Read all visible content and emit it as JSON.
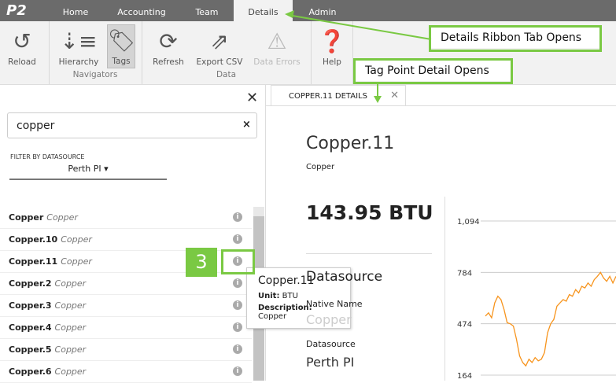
{
  "app": {
    "logo": "P2"
  },
  "tabs": [
    "Home",
    "Accounting",
    "Team",
    "Details",
    "Admin"
  ],
  "active_tab": "Details",
  "ribbon": {
    "buttons": [
      {
        "label": "Reload",
        "icon": "reload-icon"
      },
      {
        "label": "Hierarchy",
        "icon": "hierarchy-icon"
      },
      {
        "label": "Tags",
        "icon": "tag-icon",
        "selected": true
      },
      {
        "label": "Refresh",
        "icon": "refresh-icon"
      },
      {
        "label": "Export CSV",
        "icon": "export-icon"
      },
      {
        "label": "Data Errors",
        "icon": "warning-icon",
        "disabled": true
      },
      {
        "label": "Help",
        "icon": "help-icon"
      }
    ],
    "groups": [
      "Navigators",
      "Data"
    ]
  },
  "left": {
    "search_value": "copper",
    "filter_label": "FILTER BY DATASOURCE",
    "filter_value": "Perth PI",
    "items": [
      {
        "name": "Copper",
        "desc": "Copper"
      },
      {
        "name": "Copper.10",
        "desc": "Copper"
      },
      {
        "name": "Copper.11",
        "desc": "Copper"
      },
      {
        "name": "Copper.2",
        "desc": "Copper"
      },
      {
        "name": "Copper.3",
        "desc": "Copper"
      },
      {
        "name": "Copper.4",
        "desc": "Copper"
      },
      {
        "name": "Copper.5",
        "desc": "Copper"
      },
      {
        "name": "Copper.6",
        "desc": "Copper"
      }
    ]
  },
  "tooltip": {
    "title": "Copper.11",
    "unit_label": "Unit:",
    "unit": "BTU",
    "desc_label": "Description:",
    "desc": "Copper"
  },
  "detail": {
    "tab_label": "COPPER.11 DETAILS",
    "title": "Copper.11",
    "subtitle": "Copper",
    "value": "143.95 BTU",
    "section": "Datasource",
    "native_name_label": "Native Name",
    "native_name": "Copper",
    "datasource_label": "Datasource",
    "datasource": "Perth PI"
  },
  "chart_data": {
    "type": "line",
    "y_ticks": [
      "1,094",
      "784",
      "474",
      "164"
    ],
    "ylim": [
      164,
      1094
    ],
    "color": "#f7941d",
    "values": [
      520,
      540,
      510,
      600,
      640,
      620,
      560,
      480,
      474,
      460,
      380,
      280,
      240,
      220,
      260,
      240,
      270,
      250,
      260,
      300,
      420,
      474,
      500,
      580,
      600,
      620,
      610,
      650,
      640,
      680,
      660,
      700,
      690,
      720,
      700,
      740,
      760,
      784,
      750,
      730,
      760,
      720,
      760
    ]
  },
  "annotations": {
    "step": "3",
    "ribbon_note": "Details Ribbon Tab Opens",
    "detail_note": "Tag Point Detail Opens",
    "accent": "#7ac943"
  }
}
